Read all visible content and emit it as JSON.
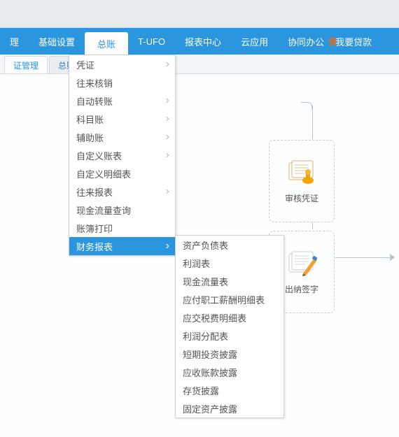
{
  "top_menu": {
    "items": [
      "理",
      "基础设置",
      "总账",
      "T-UFO",
      "报表中心",
      "云应用",
      "协同办公"
    ],
    "active_index": 2,
    "promo_label": "贷",
    "loan_label": "我要贷款"
  },
  "tabs": {
    "t0": "证管理",
    "t1": "总账"
  },
  "dropdown": {
    "items": [
      {
        "label": "凭证",
        "sub": true
      },
      {
        "label": "往来核销"
      },
      {
        "label": "自动转账",
        "sub": true
      },
      {
        "label": "科目账",
        "sub": true
      },
      {
        "label": "辅助账",
        "sub": true
      },
      {
        "label": "自定义账表",
        "sub": true
      },
      {
        "label": "自定义明细表"
      },
      {
        "label": "往来报表",
        "sub": true
      },
      {
        "label": "现金流量查询"
      },
      {
        "label": "账簿打印"
      },
      {
        "label": "财务报表",
        "sub": true,
        "hl": true
      }
    ]
  },
  "submenu": {
    "items": [
      "资产负债表",
      "利润表",
      "现金流量表",
      "应付职工薪酬明细表",
      "应交税费明细表",
      "利润分配表",
      "短期投资披露",
      "应收账款披露",
      "存货披露",
      "固定资产披露"
    ]
  },
  "flow": {
    "node1": "审核凭证",
    "node2": "出纳签字"
  }
}
